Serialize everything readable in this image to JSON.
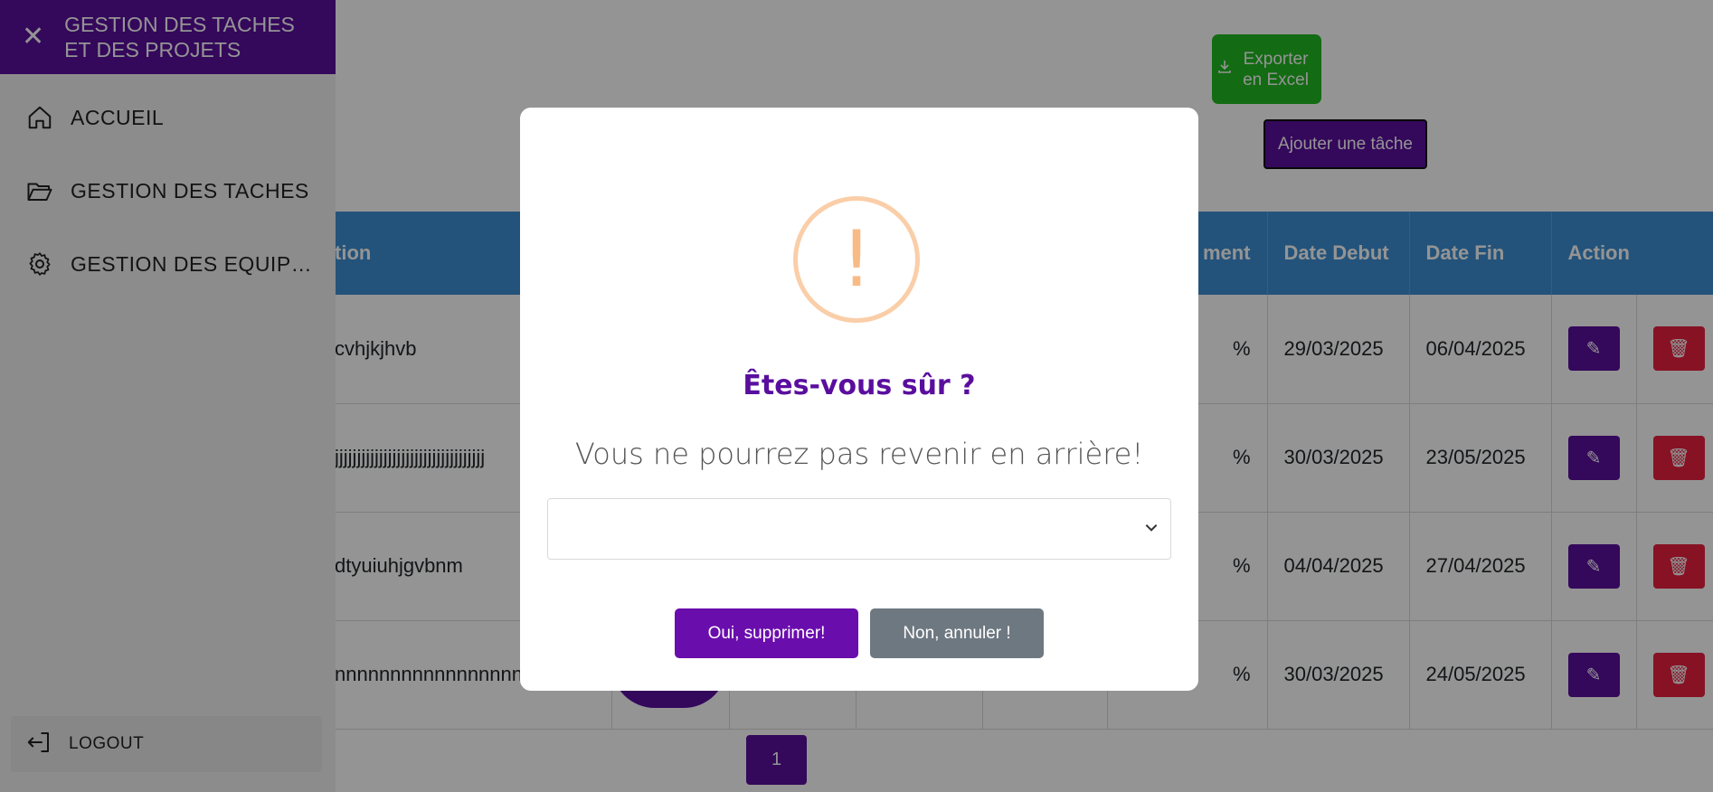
{
  "toolbar": {
    "export_label": "Exporter en Excel",
    "add_label": "Ajouter une tâche"
  },
  "table": {
    "headers": [
      "tion",
      "ment",
      "Date Debut",
      "Date Fin",
      "Action"
    ],
    "rows": [
      {
        "name": "cvhjkjhvb",
        "pct": "%",
        "start": "29/03/2025",
        "end": "06/04/2025"
      },
      {
        "name": "jjjjjjjjjjjjjjjjjjjjjjjjjjjjjjjjjj",
        "pct": "%",
        "start": "30/03/2025",
        "end": "23/05/2025"
      },
      {
        "name": "dtyuiuhjgvbnm",
        "pct": "%",
        "start": "04/04/2025",
        "end": "27/04/2025"
      },
      {
        "name": "nnnnnnnnnnnnnnnnnnnn",
        "pct": "%",
        "start": "30/03/2025",
        "end": "24/05/2025"
      }
    ]
  },
  "pagination": {
    "current": "1"
  },
  "sidebar": {
    "title": "GESTION DES TACHES ET DES PROJETS",
    "items": [
      {
        "label": "ACCUEIL",
        "icon": "home-icon"
      },
      {
        "label": "GESTION DES TACHES",
        "icon": "folder-open-icon"
      },
      {
        "label": "GESTION DES EQUIPES",
        "icon": "gear-icon"
      }
    ],
    "logout_label": "LOGOUT"
  },
  "modal": {
    "icon": "!",
    "title": "Êtes-vous sûr ?",
    "text": "Vous ne pourrez pas revenir en arrière!",
    "select_value": "",
    "confirm_label": "Oui, supprimer!",
    "cancel_label": "Non, annuler !"
  },
  "colors": {
    "brand": "#5a0e9e",
    "export": "#22b922",
    "table_header": "#3d8fd4",
    "delete": "#e8203f",
    "cancel": "#6e7881",
    "warning": "#f8bb86"
  }
}
